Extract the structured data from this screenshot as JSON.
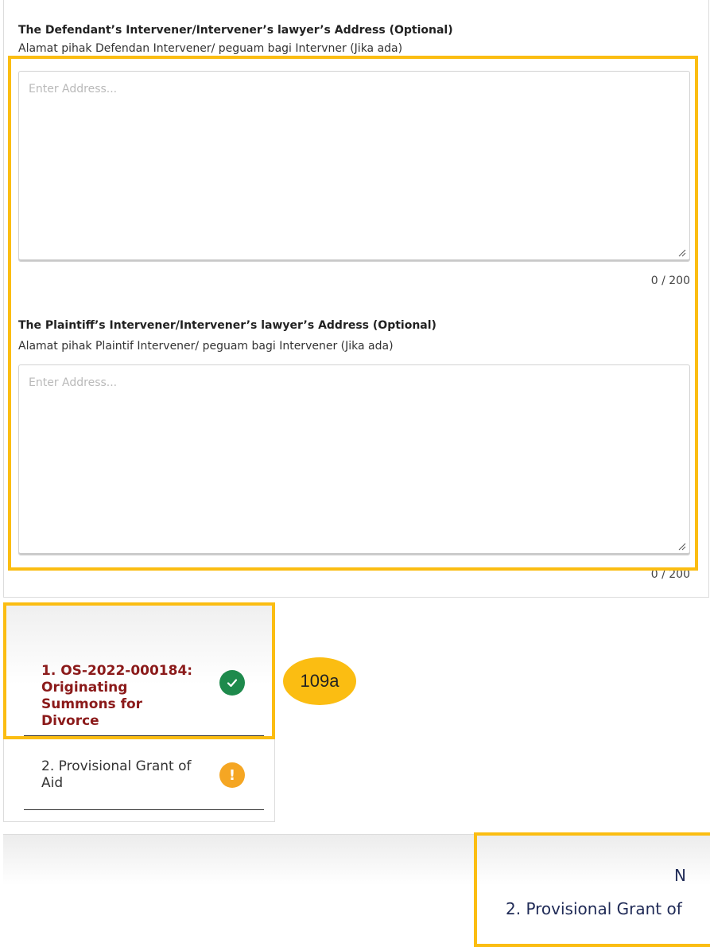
{
  "fields": [
    {
      "label": "The Defendant’s Intervener/Intervener’s lawyer’s Address (Optional)",
      "sublabel": "Alamat pihak Defendan Intervener/ peguam bagi Intervner (Jika ada)",
      "placeholder": "Enter Address...",
      "value": "",
      "counter": "0 / 200"
    },
    {
      "label": "The Plaintiff’s Intervener/Intervener’s lawyer’s Address (Optional)",
      "sublabel": "Alamat pihak Plaintif Intervener/ peguam bagi Intervener (Jika ada)",
      "placeholder": "Enter Address...",
      "value": "",
      "counter": "0 / 200"
    }
  ],
  "steps": [
    {
      "label": "1. OS-2022-000184: Originating Summons for Divorce",
      "status": "complete",
      "status_icon": "check-icon"
    },
    {
      "label": "2. Provisional Grant of Aid",
      "status": "warning",
      "status_icon": "exclamation-icon"
    }
  ],
  "callout": {
    "label": "109a"
  },
  "next_button": {
    "title": "N",
    "subtitle": "2. Provisional Grant of"
  },
  "colors": {
    "highlight": "#fbbd12",
    "active_step_text": "#8b1a1a",
    "complete_icon": "#1e8a4c",
    "warning_icon": "#f5a623",
    "next_text": "#1f2a56"
  }
}
